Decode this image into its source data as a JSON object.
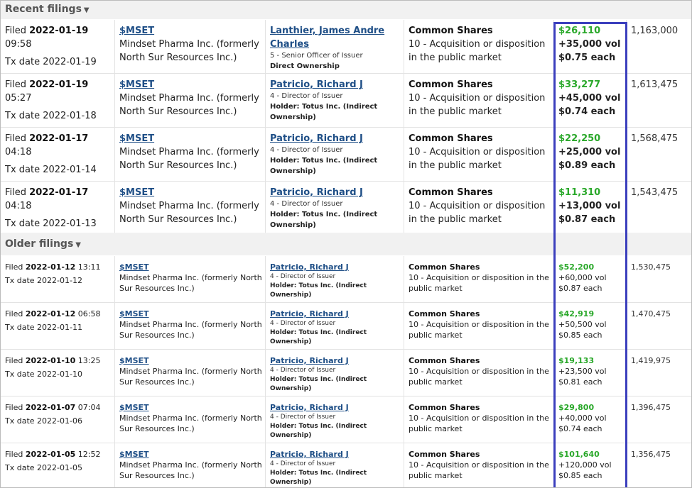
{
  "sections": {
    "recent_title": "Recent filings",
    "older_title": "Older filings"
  },
  "recent_rows": [
    {
      "filed_prefix": "Filed",
      "filed_date": "2022-01-19",
      "filed_time": "09:58",
      "tx_date": "Tx date 2022-01-19",
      "ticker": "$MSET",
      "company": "Mindset Pharma Inc. (formerly North Sur Resources Inc.)",
      "insider": "Lanthier, James Andre Charles",
      "role": "5 - Senior Officer of Issuer",
      "holder": "Direct Ownership",
      "type_title": "Common Shares",
      "type_desc": "10 - Acquisition or disposition in the public market",
      "value": "$26,110",
      "volume": "+35,000 vol",
      "price": "$0.75 each",
      "shares": "1,163,000"
    },
    {
      "filed_prefix": "Filed",
      "filed_date": "2022-01-19",
      "filed_time": "05:27",
      "tx_date": "Tx date 2022-01-18",
      "ticker": "$MSET",
      "company": "Mindset Pharma Inc. (formerly North Sur Resources Inc.)",
      "insider": "Patricio, Richard J",
      "role": "4 - Director of Issuer",
      "holder": "Holder: Totus Inc. (Indirect Ownership)",
      "type_title": "Common Shares",
      "type_desc": "10 - Acquisition or disposition in the public market",
      "value": "$33,277",
      "volume": "+45,000 vol",
      "price": "$0.74 each",
      "shares": "1,613,475"
    },
    {
      "filed_prefix": "Filed",
      "filed_date": "2022-01-17",
      "filed_time": "04:18",
      "tx_date": "Tx date 2022-01-14",
      "ticker": "$MSET",
      "company": "Mindset Pharma Inc. (formerly North Sur Resources Inc.)",
      "insider": "Patricio, Richard J",
      "role": "4 - Director of Issuer",
      "holder": "Holder: Totus Inc. (Indirect Ownership)",
      "type_title": "Common Shares",
      "type_desc": "10 - Acquisition or disposition in the public market",
      "value": "$22,250",
      "volume": "+25,000 vol",
      "price": "$0.89 each",
      "shares": "1,568,475"
    },
    {
      "filed_prefix": "Filed",
      "filed_date": "2022-01-17",
      "filed_time": "04:18",
      "tx_date": "Tx date 2022-01-13",
      "ticker": "$MSET",
      "company": "Mindset Pharma Inc. (formerly North Sur Resources Inc.)",
      "insider": "Patricio, Richard J",
      "role": "4 - Director of Issuer",
      "holder": "Holder: Totus Inc. (Indirect Ownership)",
      "type_title": "Common Shares",
      "type_desc": "10 - Acquisition or disposition in the public market",
      "value": "$11,310",
      "volume": "+13,000 vol",
      "price": "$0.87 each",
      "shares": "1,543,475"
    }
  ],
  "older_rows": [
    {
      "filed_prefix": "Filed",
      "filed_date": "2022-01-12",
      "filed_time": "13:11",
      "tx_date": "Tx date 2022-01-12",
      "ticker": "$MSET",
      "company": "Mindset Pharma Inc. (formerly North Sur Resources Inc.)",
      "insider": "Patricio, Richard J",
      "role": "4 - Director of Issuer",
      "holder": "Holder: Totus Inc. (Indirect Ownership)",
      "type_title": "Common Shares",
      "type_desc": "10 - Acquisition or disposition in the public market",
      "value": "$52,200",
      "volume": "+60,000 vol",
      "price": "$0.87 each",
      "shares": "1,530,475"
    },
    {
      "filed_prefix": "Filed",
      "filed_date": "2022-01-12",
      "filed_time": "06:58",
      "tx_date": "Tx date 2022-01-11",
      "ticker": "$MSET",
      "company": "Mindset Pharma Inc. (formerly North Sur Resources Inc.)",
      "insider": "Patricio, Richard J",
      "role": "4 - Director of Issuer",
      "holder": "Holder: Totus Inc. (Indirect Ownership)",
      "type_title": "Common Shares",
      "type_desc": "10 - Acquisition or disposition in the public market",
      "value": "$42,919",
      "volume": "+50,500 vol",
      "price": "$0.85 each",
      "shares": "1,470,475"
    },
    {
      "filed_prefix": "Filed",
      "filed_date": "2022-01-10",
      "filed_time": "13:25",
      "tx_date": "Tx date 2022-01-10",
      "ticker": "$MSET",
      "company": "Mindset Pharma Inc. (formerly North Sur Resources Inc.)",
      "insider": "Patricio, Richard J",
      "role": "4 - Director of Issuer",
      "holder": "Holder: Totus Inc. (Indirect Ownership)",
      "type_title": "Common Shares",
      "type_desc": "10 - Acquisition or disposition in the public market",
      "value": "$19,133",
      "volume": "+23,500 vol",
      "price": "$0.81 each",
      "shares": "1,419,975"
    },
    {
      "filed_prefix": "Filed",
      "filed_date": "2022-01-07",
      "filed_time": "07:04",
      "tx_date": "Tx date 2022-01-06",
      "ticker": "$MSET",
      "company": "Mindset Pharma Inc. (formerly North Sur Resources Inc.)",
      "insider": "Patricio, Richard J",
      "role": "4 - Director of Issuer",
      "holder": "Holder: Totus Inc. (Indirect Ownership)",
      "type_title": "Common Shares",
      "type_desc": "10 - Acquisition or disposition in the public market",
      "value": "$29,800",
      "volume": "+40,000 vol",
      "price": "$0.74 each",
      "shares": "1,396,475"
    },
    {
      "filed_prefix": "Filed",
      "filed_date": "2022-01-05",
      "filed_time": "12:52",
      "tx_date": "Tx date 2022-01-05",
      "ticker": "$MSET",
      "company": "Mindset Pharma Inc. (formerly North Sur Resources Inc.)",
      "insider": "Patricio, Richard J",
      "role": "4 - Director of Issuer",
      "holder": "Holder: Totus Inc. (Indirect Ownership)",
      "type_title": "Common Shares",
      "type_desc": "10 - Acquisition or disposition in the public market",
      "value": "$101,640",
      "volume": "+120,000 vol",
      "price": "$0.85 each",
      "shares": "1,356,475"
    }
  ],
  "colors": {
    "value_green": "#2aa82a",
    "link_blue": "#1e4e86",
    "highlight_box": "#3b3fbd"
  }
}
